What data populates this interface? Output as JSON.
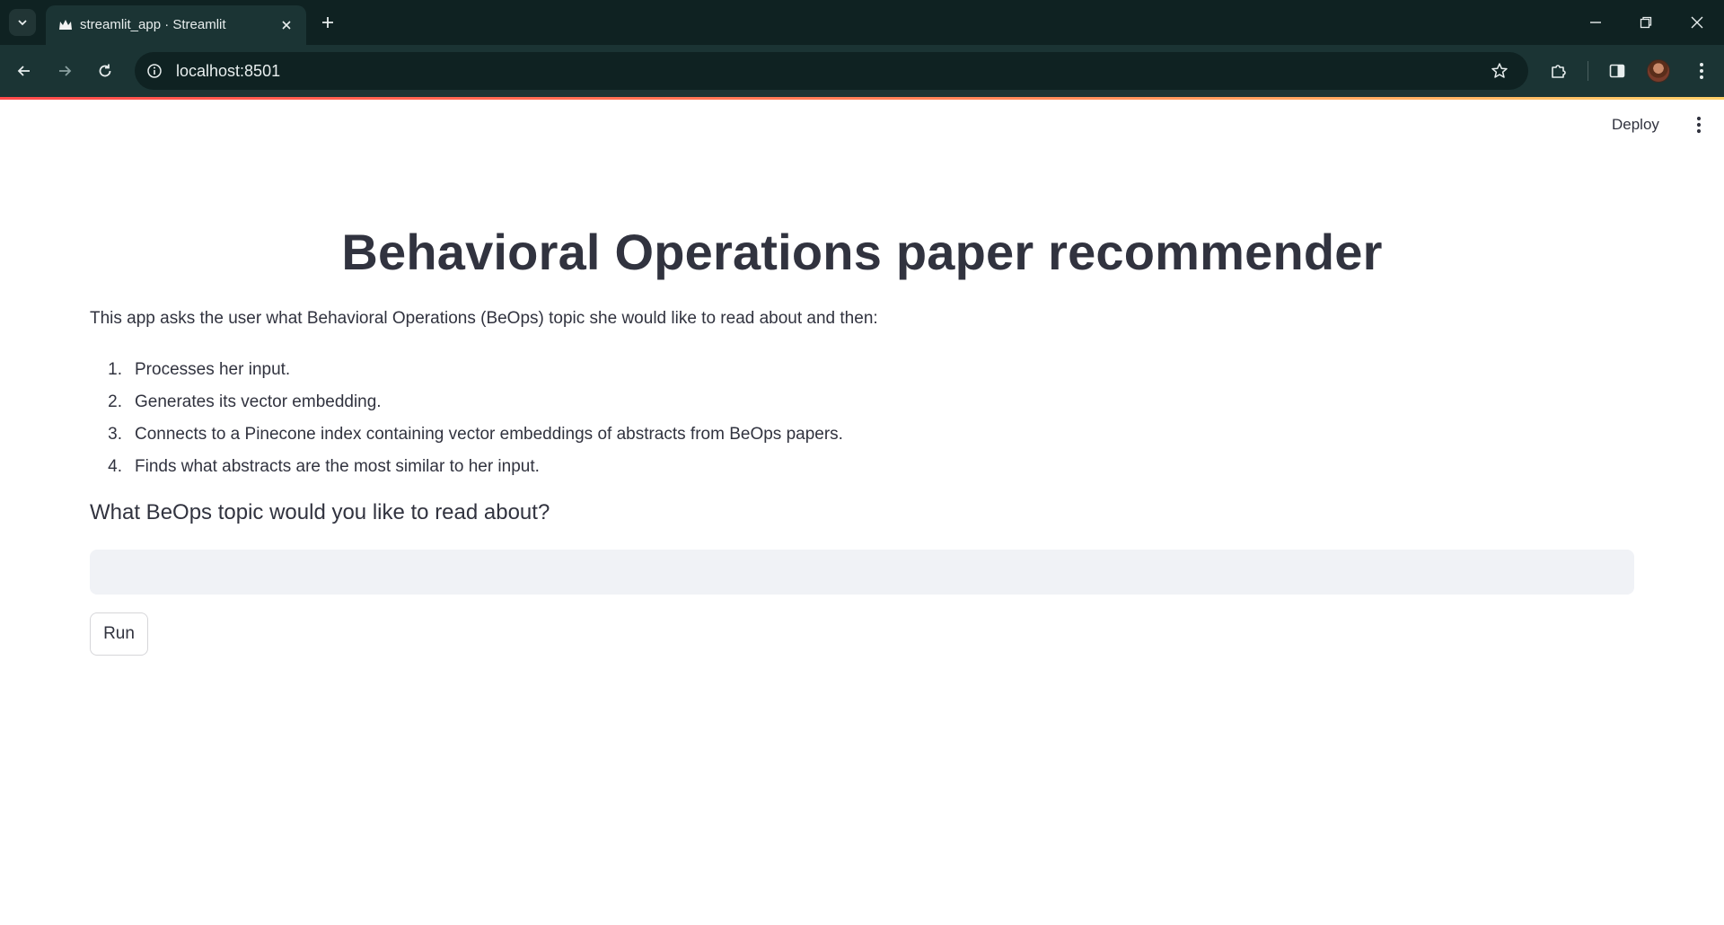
{
  "browser": {
    "tab_title": "streamlit_app · Streamlit",
    "url": "localhost:8501",
    "icons": {
      "tab_search": "chevron-down-icon",
      "favicon": "streamlit-crown-icon",
      "tab_close": "close-icon",
      "new_tab": "plus-icon",
      "minimize": "minimize-icon",
      "restore": "restore-icon",
      "close_window": "close-icon",
      "back": "arrow-left-icon",
      "forward": "arrow-right-icon",
      "reload": "reload-icon",
      "site_info": "info-icon",
      "bookmark": "star-icon",
      "extensions": "puzzle-icon",
      "side_panel": "side-panel-icon",
      "profile": "avatar",
      "menu": "kebab-menu-icon"
    }
  },
  "app": {
    "header": {
      "deploy_label": "Deploy",
      "menu_icon": "kebab-menu-icon"
    },
    "title": "Behavioral Operations paper recommender",
    "intro": "This app asks the user what Behavioral Operations (BeOps) topic she would like to read about and then:",
    "steps": [
      {
        "num": "1.",
        "text": "Processes her input."
      },
      {
        "num": "2.",
        "text": "Generates its vector embedding."
      },
      {
        "num": "3.",
        "text": "Connects to a Pinecone index containing vector embeddings of abstracts from BeOps papers."
      },
      {
        "num": "4.",
        "text": "Finds what abstracts are the most similar to her input."
      }
    ],
    "question": "What BeOps topic would you like to read about?",
    "input": {
      "value": "",
      "placeholder": ""
    },
    "run_label": "Run"
  },
  "colors": {
    "chrome_dark": "#0f2222",
    "chrome_toolbar": "#1b3434",
    "text": "#31333f",
    "input_bg": "#f0f2f6",
    "streamlit_accent": "#ff4b4b"
  }
}
